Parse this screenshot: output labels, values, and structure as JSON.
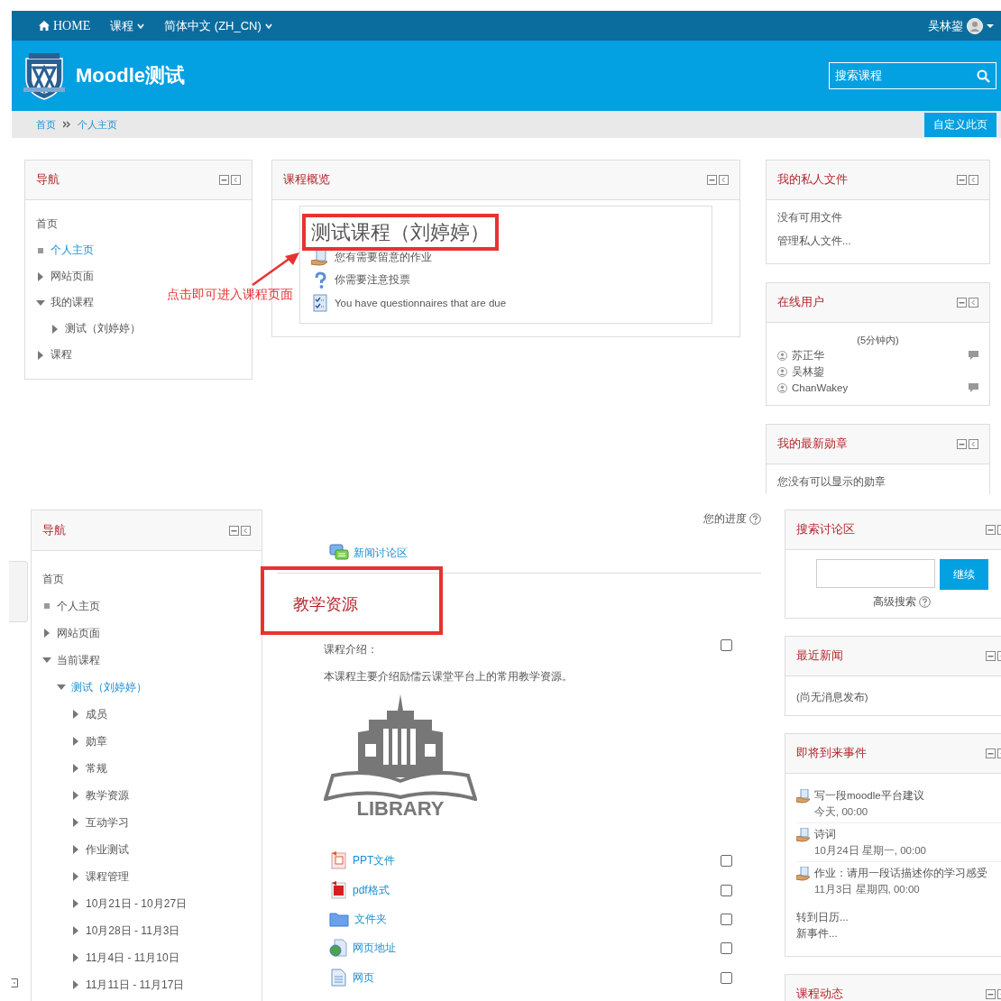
{
  "dashboard": {
    "navbar": {
      "home": "HOME",
      "menus": [
        "课程",
        "简体中文 (ZH_CN)"
      ],
      "user": "吴林鋆"
    },
    "site_name": "Moodle测试",
    "search": {
      "placeholder": "搜索课程"
    },
    "breadcrumb": [
      "首页",
      "个人主页"
    ],
    "customize_button": "自定义此页",
    "nav_block": {
      "title": "导航",
      "items": [
        {
          "label": "首页",
          "kind": "root",
          "current": false
        },
        {
          "label": "个人主页",
          "kind": "leaf",
          "current": true
        },
        {
          "label": "网站页面",
          "kind": "branch",
          "expanded": false,
          "current": false
        },
        {
          "label": "我的课程",
          "kind": "branch",
          "expanded": true,
          "current": false,
          "children": [
            {
              "label": "测试（刘婷婷）",
              "kind": "branch",
              "expanded": false,
              "current": false
            }
          ]
        },
        {
          "label": "课程",
          "kind": "branch",
          "expanded": false,
          "current": false
        }
      ]
    },
    "course_overview": {
      "title": "课程概览",
      "course_title": "测试课程（刘婷婷）",
      "notices": [
        {
          "kind": "assignment",
          "text": "您有需要留意的作业"
        },
        {
          "kind": "vote",
          "text": "你需要注意投票"
        },
        {
          "kind": "questionnaire",
          "text": "You have questionnaires that are due"
        }
      ]
    },
    "annotation": "点击即可进入课程页面",
    "private_files": {
      "title": "我的私人文件",
      "items": [
        "没有可用文件",
        "管理私人文件..."
      ]
    },
    "online_users": {
      "title": "在线用户",
      "period": "(5分钟内)",
      "users": [
        {
          "name": "苏正华",
          "message": true
        },
        {
          "name": "吴林鋆",
          "message": false
        },
        {
          "name": "ChanWakey",
          "message": true
        }
      ]
    },
    "badges": {
      "title": "我的最新勋章",
      "text": "您没有可以显示的勋章"
    }
  },
  "course_page": {
    "nav_block": {
      "title": "导航",
      "items": [
        {
          "label": "首页",
          "kind": "root",
          "current": false
        },
        {
          "label": "个人主页",
          "kind": "leaf",
          "current": false
        },
        {
          "label": "网站页面",
          "kind": "branch",
          "expanded": false,
          "current": false
        },
        {
          "label": "当前课程",
          "kind": "branch",
          "expanded": true,
          "current": false,
          "children": [
            {
              "label": "测试（刘婷婷）",
              "kind": "branch",
              "expanded": true,
              "current": true,
              "children": [
                {
                  "label": "成员",
                  "kind": "branch",
                  "expanded": false,
                  "current": false
                },
                {
                  "label": "勋章",
                  "kind": "branch",
                  "expanded": false,
                  "current": false
                },
                {
                  "label": "常规",
                  "kind": "branch",
                  "expanded": false,
                  "current": false
                },
                {
                  "label": "教学资源",
                  "kind": "branch",
                  "expanded": false,
                  "current": false
                },
                {
                  "label": "互动学习",
                  "kind": "branch",
                  "expanded": false,
                  "current": false
                },
                {
                  "label": "作业测试",
                  "kind": "branch",
                  "expanded": false,
                  "current": false
                },
                {
                  "label": "课程管理",
                  "kind": "branch",
                  "expanded": false,
                  "current": false
                },
                {
                  "label": "10月21日 - 10月27日",
                  "kind": "branch",
                  "expanded": false,
                  "current": false
                },
                {
                  "label": "10月28日 - 11月3日",
                  "kind": "branch",
                  "expanded": false,
                  "current": false
                },
                {
                  "label": "11月4日 - 11月10日",
                  "kind": "branch",
                  "expanded": false,
                  "current": false
                },
                {
                  "label": "11月11日 - 11月17日",
                  "kind": "branch",
                  "expanded": false,
                  "current": false
                }
              ]
            }
          ]
        }
      ]
    },
    "progress_label": "您的进度",
    "forum_link": "新闻讨论区",
    "section_title": "教学资源",
    "intro": {
      "label": "课程介绍：",
      "checked": false,
      "text": "本课程主要介绍励儒云课堂平台上的常用教学资源。",
      "image_caption": "LIBRARY"
    },
    "activities": [
      {
        "kind": "ppt",
        "name": "PPT文件",
        "checked": false
      },
      {
        "kind": "pdf",
        "name": "pdf格式",
        "checked": false
      },
      {
        "kind": "folder",
        "name": "文件夹",
        "checked": false
      },
      {
        "kind": "url",
        "name": "网页地址",
        "checked": false
      },
      {
        "kind": "page",
        "name": "网页",
        "checked": false
      }
    ],
    "search_forums": {
      "title": "搜索讨论区",
      "button": "继续",
      "advanced": "高级搜索"
    },
    "latest_news": {
      "title": "最近新闻",
      "text": "(尚无消息发布)"
    },
    "upcoming_events": {
      "title": "即将到来事件",
      "events": [
        {
          "name": "写一段moodle平台建议",
          "date": "今天, 00:00"
        },
        {
          "name": "诗词",
          "date": "10月24日 星期一, 00:00"
        },
        {
          "name": "作业：请用一段话描述你的学习感受",
          "date": "11月3日 星期四, 00:00"
        }
      ],
      "links": [
        "转到日历...",
        "新事件..."
      ]
    },
    "recent_activity": {
      "title": "课程动态"
    }
  }
}
